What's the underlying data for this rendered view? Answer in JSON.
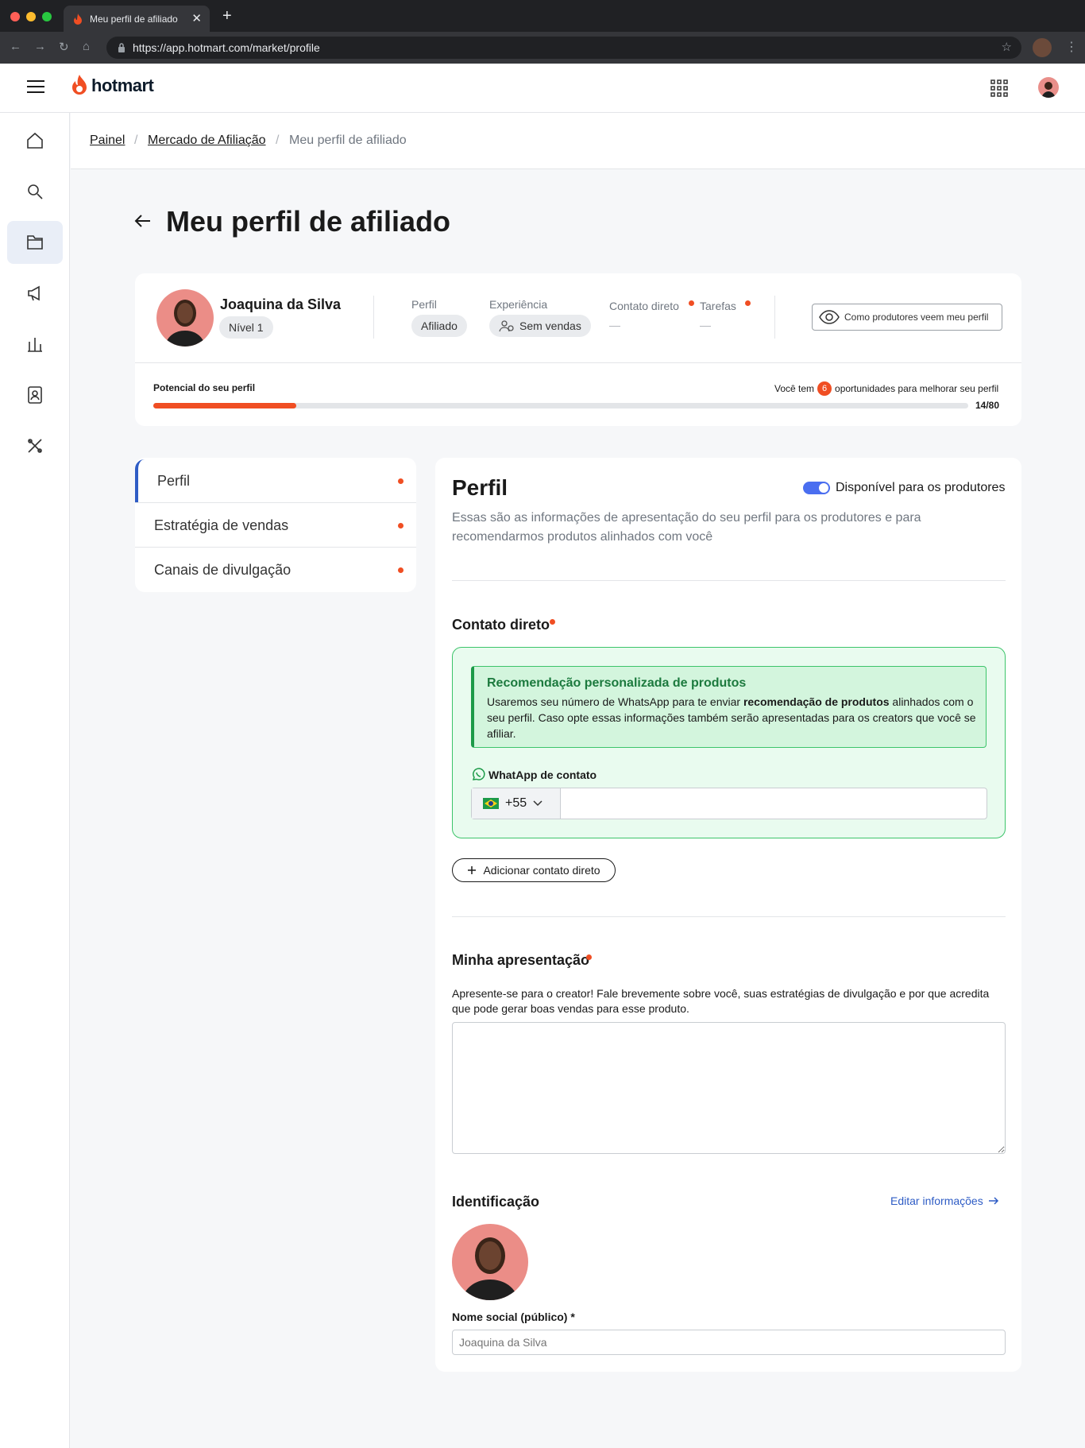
{
  "browser": {
    "tab_title": "Meu perfil de afiliado",
    "url": "https://app.hotmart.com/market/profile"
  },
  "header": {
    "logo_text": "hotmart",
    "brand_color": "#f04e23"
  },
  "breadcrumb": {
    "items": [
      "Painel",
      "Mercado de Afiliação",
      "Meu perfil de afiliado"
    ],
    "separator": "/"
  },
  "page": {
    "title": "Meu perfil de afiliado"
  },
  "summary": {
    "name": "Joaquina da Silva",
    "level": "Nível 1",
    "perfil_label": "Perfil",
    "perfil_value": "Afiliado",
    "experiencia_label": "Experiência",
    "experiencia_value": "Sem vendas",
    "contato_label": "Contato direto",
    "contato_value": "—",
    "tarefas_label": "Tarefas",
    "tarefas_value": "—",
    "view_button": "Como produtores veem meu perfil",
    "potential_label": "Potencial do seu perfil",
    "opportunities_prefix": "Você tem",
    "opportunities_count": "6",
    "opportunities_suffix": "oportunidades para melhorar seu perfil",
    "progress_text": "14/80",
    "progress_fraction": 0.175
  },
  "left_nav": {
    "items": [
      {
        "label": "Perfil",
        "active": true
      },
      {
        "label": "Estratégia de vendas",
        "active": false
      },
      {
        "label": "Canais de divulgação",
        "active": false
      }
    ]
  },
  "main": {
    "title": "Perfil",
    "toggle_label": "Disponível para os produtores",
    "toggle_on": true,
    "description": "Essas são as informações de apresentação do seu perfil para os produtores e para recomendarmos produtos alinhados com você",
    "contact": {
      "title": "Contato direto",
      "reco_title": "Recomendação personalizada de produtos",
      "reco_body_1": "Usaremos seu número de WhatsApp para te enviar ",
      "reco_body_bold": "recomendação de produtos",
      "reco_body_2": " alinhados com o seu perfil. Caso opte essas informações também serão apresentadas para os creators que você se afiliar.",
      "whatsapp_label": "WhatApp de contato",
      "country_code": "+55",
      "phone_value": "",
      "add_button": "Adicionar contato direto"
    },
    "presentation": {
      "title": "Minha apresentação",
      "hint": "Apresente-se para o creator! Fale brevemente sobre você, suas estratégias de divulgação e por que acredita que pode gerar boas vendas para esse produto.",
      "value": ""
    },
    "identification": {
      "title": "Identificação",
      "edit_link": "Editar informações",
      "name_label": "Nome social (público) *",
      "name_placeholder": "Joaquina da Silva"
    }
  }
}
